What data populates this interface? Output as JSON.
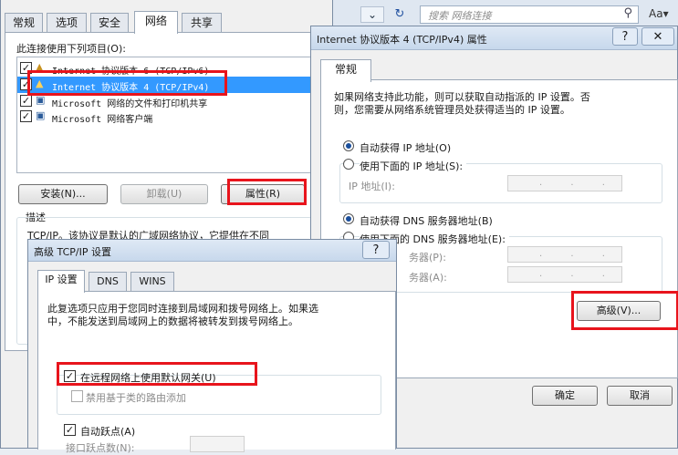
{
  "lan": {
    "tabs": [
      "常规",
      "选项",
      "安全",
      "网络",
      "共享"
    ],
    "connect_label": "此连接使用下列项目(O):",
    "items": [
      {
        "label": "Internet 协议版本 6 (TCP/IPv6)",
        "checked": true
      },
      {
        "label": "Internet 协议版本 4 (TCP/IPv4)",
        "checked": true
      },
      {
        "label": "Microsoft 网络的文件和打印机共享",
        "checked": true
      },
      {
        "label": "Microsoft 网络客户端",
        "checked": true
      }
    ],
    "install": "安装(N)...",
    "uninstall": "卸载(U)",
    "properties": "属性(R)",
    "desc_title": "描述",
    "desc_text": "TCP/IP。该协议是默认的广域网络协议，它提供在不同"
  },
  "explorer": {
    "search_placeholder": "搜索 网络连接"
  },
  "ipv4": {
    "title": "Internet 协议版本 4 (TCP/IPv4) 属性",
    "help": "?",
    "close": "✕",
    "tab": "常规",
    "intro1": "如果网络支持此功能，则可以获取自动指派的 IP 设置。否",
    "intro2": "则，您需要从网络系统管理员处获得适当的 IP 设置。",
    "auto_ip": "自动获得 IP 地址(O)",
    "manual_ip": "使用下面的 IP 地址(S):",
    "ip_addr": "IP 地址(I):",
    "auto_dns": "自动获得 DNS 服务器地址(B)",
    "manual_dns": "使用下面的 DNS 服务器地址(E):",
    "pref_dns": "务器(P):",
    "alt_dns": "务器(A):",
    "dots": ". . .",
    "advanced": "高级(V)...",
    "ok": "确定",
    "cancel": "取消"
  },
  "adv": {
    "title": "高级 TCP/IP 设置",
    "help": "?",
    "tabs": [
      "IP 设置",
      "DNS",
      "WINS"
    ],
    "intro1": "此复选项只应用于您同时连接到局域网和拨号网络上。如果选",
    "intro2": "中，不能发送到局域网上的数据将被转发到拨号网络上。",
    "use_gateway": "在远程网络上使用默认网关(U)",
    "class_route": "禁用基于类的路由添加",
    "auto_metric": "自动跃点(A)",
    "iface_metric": "接口跃点数(N):"
  }
}
